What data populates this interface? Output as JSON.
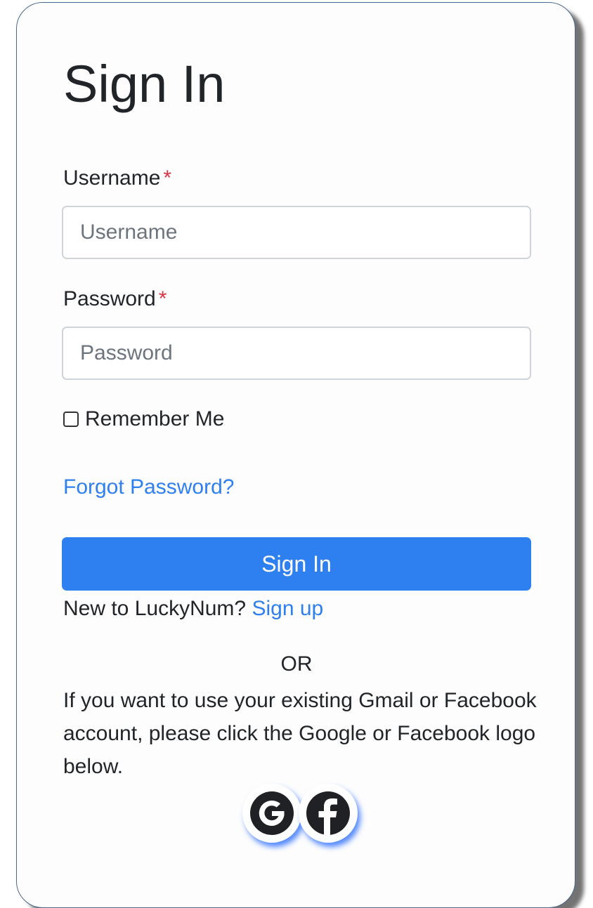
{
  "form": {
    "title": "Sign In",
    "username_label": "Username",
    "username_placeholder": "Username",
    "username_value": "",
    "password_label": "Password",
    "password_placeholder": "Password",
    "password_value": "",
    "required_marker": "*",
    "remember_label": "Remember Me",
    "remember_checked": false,
    "forgot_link": "Forgot Password?",
    "submit_label": "Sign In",
    "new_to_text": "New to LuckyNum?",
    "signup_link": "Sign up",
    "or_text": "OR",
    "social_info": "If you want to use your existing Gmail or Facebook account, please click the Google or Facebook logo below."
  },
  "social": [
    {
      "name": "Google",
      "icon": "google-icon"
    },
    {
      "name": "Facebook",
      "icon": "facebook-icon"
    }
  ],
  "colors": {
    "accent": "#2e7ff0",
    "required": "#dc3545",
    "text": "#212529",
    "placeholder": "#6c757d",
    "card_border": "#4a6a8f"
  }
}
